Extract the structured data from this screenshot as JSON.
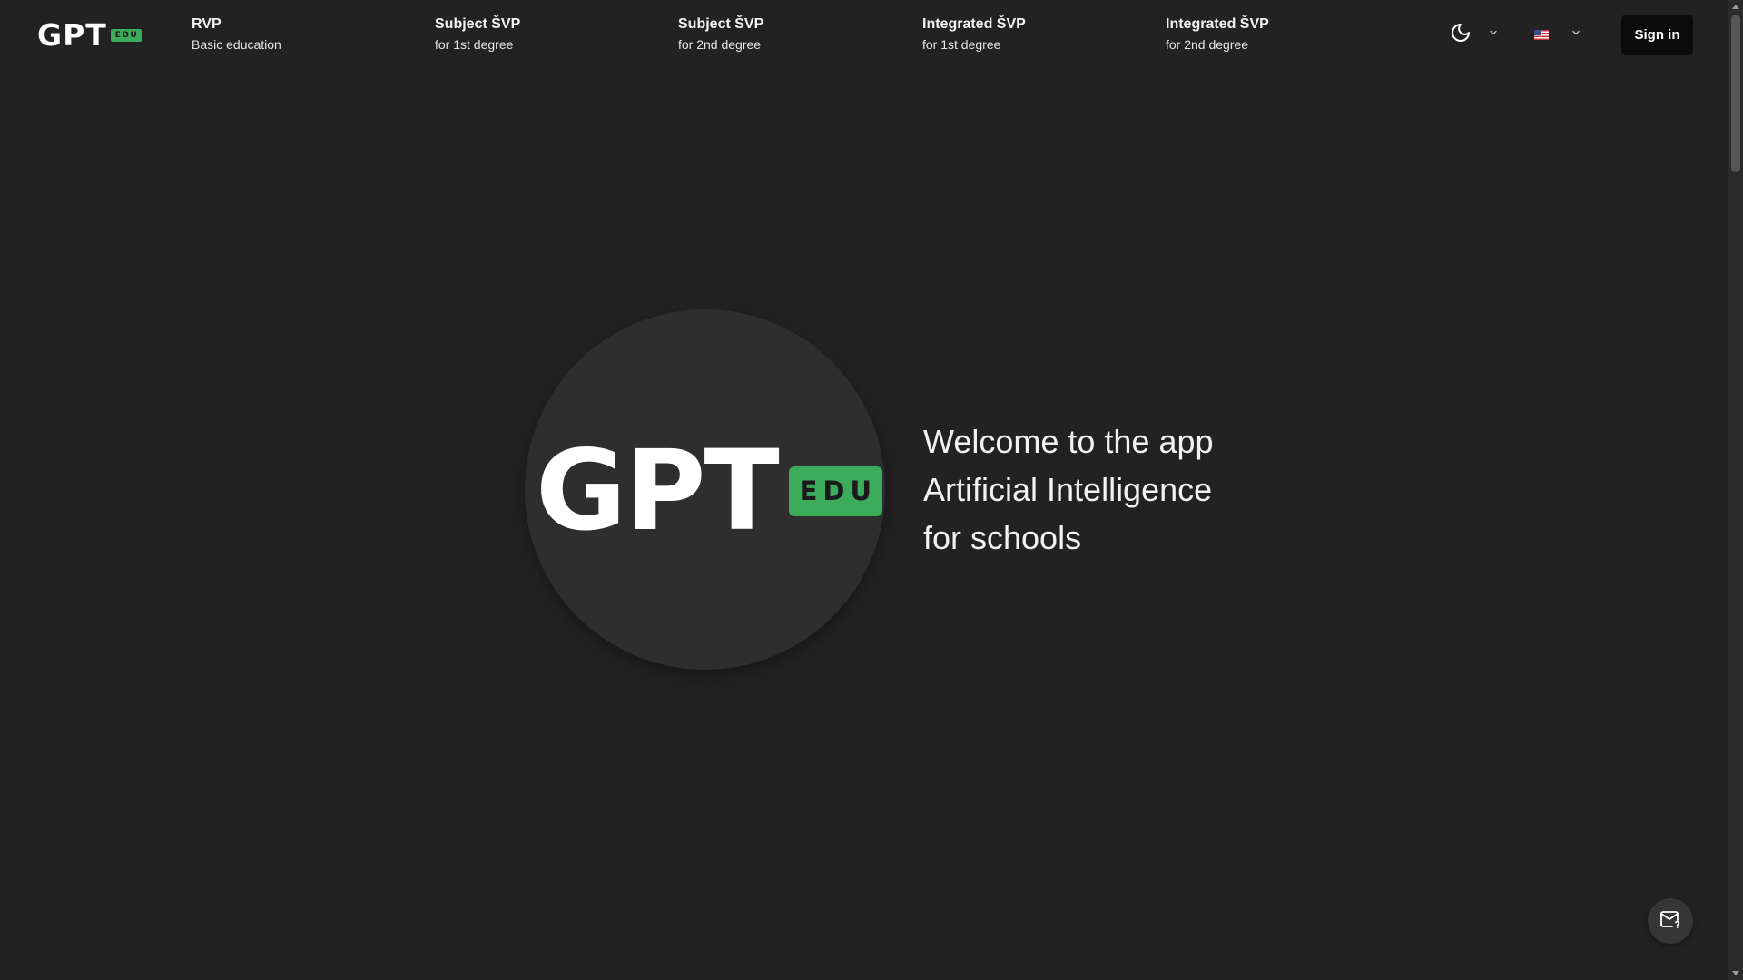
{
  "header": {
    "logo": {
      "text": "GPT",
      "badge": "EDU"
    },
    "nav": [
      {
        "title": "RVP",
        "subtitle": "Basic education"
      },
      {
        "title": "Subject ŠVP",
        "subtitle": "for 1st degree"
      },
      {
        "title": "Subject ŠVP",
        "subtitle": "for 2nd degree"
      },
      {
        "title": "Integrated ŠVP",
        "subtitle": "for 1st degree"
      },
      {
        "title": "Integrated ŠVP",
        "subtitle": "for 2nd degree"
      }
    ],
    "theme_icon": "moon-icon",
    "language_icon": "us-flag-icon",
    "sign_in_label": "Sign in"
  },
  "hero": {
    "logo_text": "GPT",
    "logo_badge": "EDU",
    "welcome_lines": [
      "Welcome to the app",
      "Artificial Intelligence",
      "for schools"
    ]
  },
  "feedback_icon": "mail-question-icon",
  "colors": {
    "background": "#222222",
    "accent": "#3dab5c",
    "button": "#0b0b0b",
    "circle": "#2e2e2e"
  }
}
